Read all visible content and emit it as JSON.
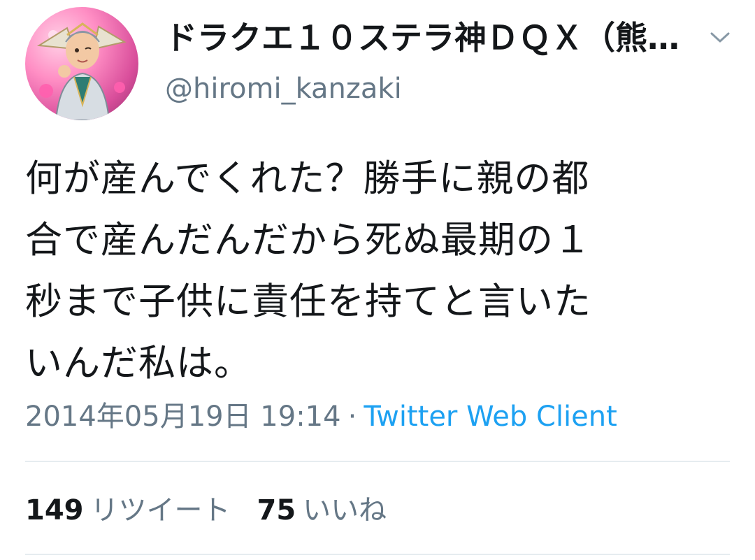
{
  "tweet": {
    "display_name": "ドラクエ１０ステラ神ＤＱＸ（熊…",
    "handle": "@hiromi_kanzaki",
    "text": "何が産んでくれた？勝手に親の都\n合で産んだんだから死ぬ最期の１\n秒まで子供に責任を持てと言いた\nいんだ私は。",
    "timestamp": "2014年05月19日 19:14",
    "separator": "·",
    "source": "Twitter Web Client",
    "retweets": {
      "count": "149",
      "label": "リツイート"
    },
    "likes": {
      "count": "75",
      "label": "いいね"
    }
  },
  "icons": {
    "caret": "chevron-down-icon",
    "avatar": "avatar"
  },
  "colors": {
    "text": "#14171a",
    "secondary": "#657786",
    "link": "#1da1f2",
    "divider": "#e6ecf0"
  }
}
